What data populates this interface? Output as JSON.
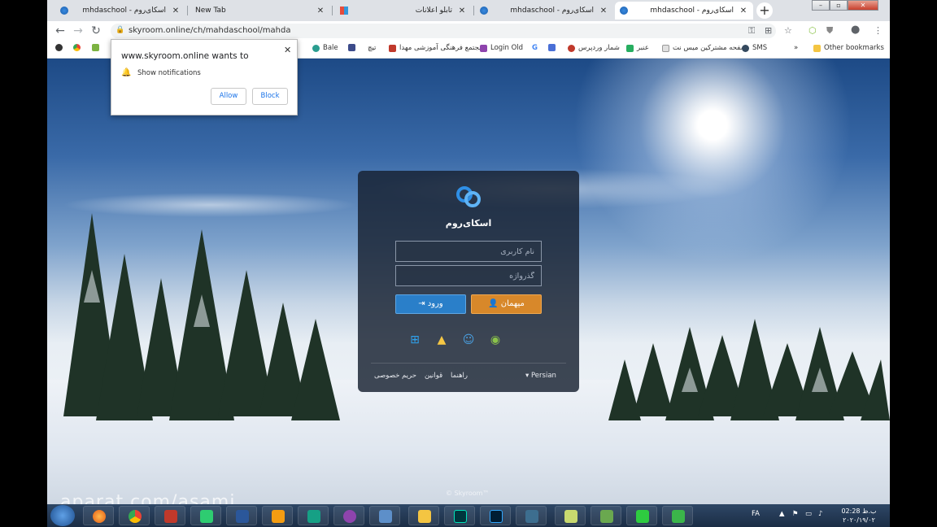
{
  "browser": {
    "tabs": [
      {
        "title": "mhdaschool - اسکای‌روم",
        "active": false
      },
      {
        "title": "New Tab",
        "active": false
      },
      {
        "title": "تابلو اعلانات",
        "active": false
      },
      {
        "title": "mhdaschool - اسکای‌روم",
        "active": false
      },
      {
        "title": "mhdaschool - اسکای‌روم",
        "active": true
      }
    ],
    "new_tab_symbol": "+",
    "url": "skyroom.online/ch/mahdaschool/mahda",
    "bookmarks": [
      {
        "label": "Bale",
        "color": "#2a9d8f"
      },
      {
        "label": "تیچ",
        "color": "#3c4b8a"
      },
      {
        "label": "مجتمع فرهنگی آموزشی مهدا",
        "color": "#c0392b"
      },
      {
        "label": "Login Old",
        "color": "#8e44ad"
      },
      {
        "label": "شمار وردپرس",
        "color": "#c0392b"
      },
      {
        "label": "عنبر",
        "color": "#27ae60"
      },
      {
        "label": "صفحه مشترکین میس نت",
        "color": "#95a5a6"
      },
      {
        "label": "SMS",
        "color": "#34495e"
      }
    ],
    "bookmarks_overflow": "»",
    "other_bookmarks": "Other bookmarks"
  },
  "notification": {
    "title": "www.skyroom.online wants to",
    "body": "Show notifications",
    "allow_label": "Allow",
    "block_label": "Block"
  },
  "login": {
    "brand": "اسکای‌روم",
    "username_placeholder": "نام کاربری",
    "password_placeholder": "گذرواژه",
    "login_label": "ورود",
    "guest_label": "میهمان",
    "language": "Persian",
    "links": {
      "guide": "راهنما",
      "rules": "قوانین",
      "privacy": "حریم خصوصی"
    },
    "copyright": "© Skyroom™"
  },
  "watermark": "aparat.com/asami",
  "taskbar": {
    "lang": "FA",
    "time": "02:28 ب.ظ",
    "date": "۲۰۲۰/۱۹/۰۲"
  },
  "colors": {
    "login_button": "#2a7fc9",
    "guest_button": "#d8882a",
    "panel": "#162030"
  }
}
